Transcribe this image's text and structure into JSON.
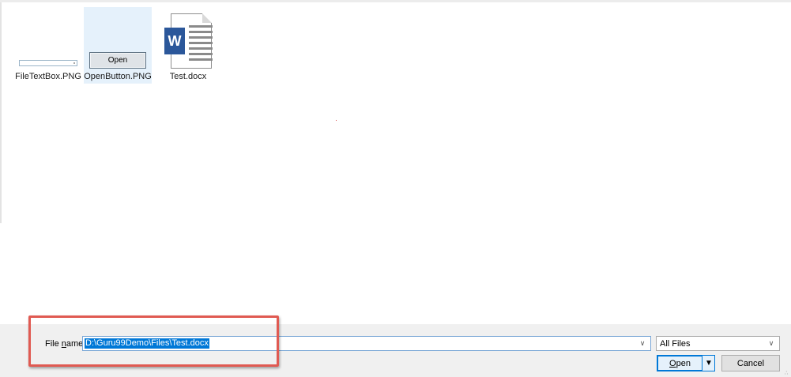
{
  "files": [
    {
      "name": "FileTextBox.PNG",
      "icon": "textbox-thumbnail-icon",
      "selected": false
    },
    {
      "name": "OpenButton.PNG",
      "icon": "open-button-thumbnail-icon",
      "selected": true,
      "thumb_text": "Open"
    },
    {
      "name": "Test.docx",
      "icon": "word-document-icon",
      "selected": false,
      "badge": "W"
    }
  ],
  "footer": {
    "file_name_label_pre": "File ",
    "file_name_label_accel": "n",
    "file_name_label_post": "ame:",
    "file_name_value": "D:\\Guru99Demo\\Files\\Test.docx",
    "file_type_value": "All Files",
    "open_accel": "O",
    "open_rest": "pen",
    "cancel_label": "Cancel"
  },
  "colors": {
    "accent": "#0078d7",
    "selection": "#e5f1fb",
    "highlight_box": "#e05a52",
    "word_blue": "#2b579a"
  }
}
